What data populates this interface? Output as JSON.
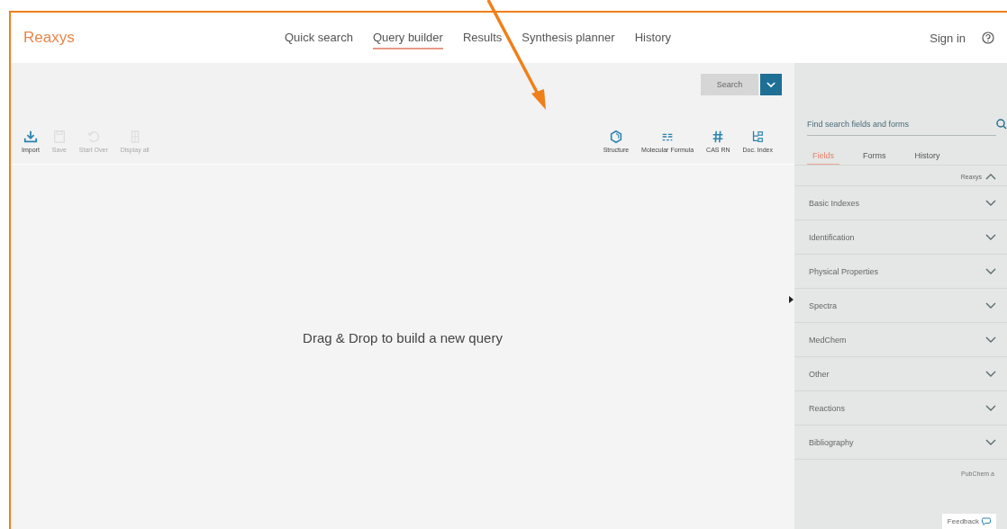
{
  "brand": "Reaxys",
  "nav": [
    {
      "label": "Quick search",
      "selected": false
    },
    {
      "label": "Query builder",
      "selected": true
    },
    {
      "label": "Results",
      "selected": false
    },
    {
      "label": "Synthesis planner",
      "selected": false
    },
    {
      "label": "History",
      "selected": false
    }
  ],
  "sign_in": "Sign in",
  "toolbar_left": [
    {
      "label": "Import",
      "kind": "import",
      "disabled": false
    },
    {
      "label": "Save",
      "kind": "save",
      "disabled": true
    },
    {
      "label": "Start Over",
      "kind": "undo",
      "disabled": true
    },
    {
      "label": "Display all",
      "kind": "columns",
      "disabled": true
    }
  ],
  "search_button": {
    "label": "Search",
    "disabled": true
  },
  "toolbar_right": [
    {
      "label": "Structure",
      "kind": "structure"
    },
    {
      "label": "Molecular Formula",
      "kind": "formula"
    },
    {
      "label": "CAS RN",
      "kind": "hash"
    },
    {
      "label": "Doc. Index",
      "kind": "tree"
    }
  ],
  "canvas": {
    "message": "Drag & Drop to build a new query"
  },
  "sidebar": {
    "search": {
      "placeholder": "Find search fields and forms"
    },
    "tabs": [
      {
        "label": "Fields",
        "selected": true
      },
      {
        "label": "Forms",
        "selected": false
      },
      {
        "label": "History",
        "selected": false
      }
    ],
    "source": {
      "label": "Reaxys",
      "expanded": true
    },
    "sections": [
      {
        "label": "Basic Indexes",
        "expanded": false
      },
      {
        "label": "Identification",
        "expanded": false
      },
      {
        "label": "Physical Properties",
        "expanded": false
      },
      {
        "label": "Spectra",
        "expanded": false
      },
      {
        "label": "MedChem",
        "expanded": false
      },
      {
        "label": "Other",
        "expanded": false
      },
      {
        "label": "Reactions",
        "expanded": false
      },
      {
        "label": "Bibliography",
        "expanded": false
      }
    ],
    "footer_text": "PubChem a",
    "feedback": "Feedback"
  }
}
